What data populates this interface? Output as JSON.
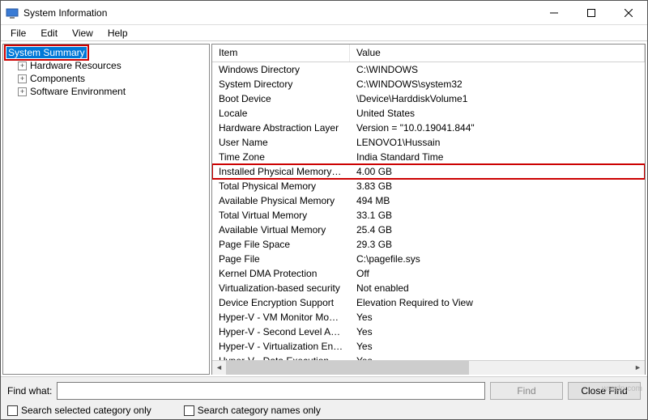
{
  "window": {
    "title": "System Information"
  },
  "menu": {
    "file": "File",
    "edit": "Edit",
    "view": "View",
    "help": "Help"
  },
  "tree": {
    "root": "System Summary",
    "hardware": "Hardware Resources",
    "components": "Components",
    "software": "Software Environment"
  },
  "columns": {
    "item": "Item",
    "value": "Value"
  },
  "rows": [
    {
      "item": "Windows Directory",
      "value": "C:\\WINDOWS"
    },
    {
      "item": "System Directory",
      "value": "C:\\WINDOWS\\system32"
    },
    {
      "item": "Boot Device",
      "value": "\\Device\\HarddiskVolume1"
    },
    {
      "item": "Locale",
      "value": "United States"
    },
    {
      "item": "Hardware Abstraction Layer",
      "value": "Version = \"10.0.19041.844\""
    },
    {
      "item": "User Name",
      "value": "LENOVO1\\Hussain"
    },
    {
      "item": "Time Zone",
      "value": "India Standard Time"
    },
    {
      "item": "Installed Physical Memory (RAM)",
      "value": "4.00 GB",
      "highlight": true
    },
    {
      "item": "Total Physical Memory",
      "value": "3.83 GB"
    },
    {
      "item": "Available Physical Memory",
      "value": "494 MB"
    },
    {
      "item": "Total Virtual Memory",
      "value": "33.1 GB"
    },
    {
      "item": "Available Virtual Memory",
      "value": "25.4 GB"
    },
    {
      "item": "Page File Space",
      "value": "29.3 GB"
    },
    {
      "item": "Page File",
      "value": "C:\\pagefile.sys"
    },
    {
      "item": "Kernel DMA Protection",
      "value": "Off"
    },
    {
      "item": "Virtualization-based security",
      "value": "Not enabled"
    },
    {
      "item": "Device Encryption Support",
      "value": "Elevation Required to View"
    },
    {
      "item": "Hyper-V - VM Monitor Mode E...",
      "value": "Yes"
    },
    {
      "item": "Hyper-V - Second Level Addres...",
      "value": "Yes"
    },
    {
      "item": "Hyper-V - Virtualization Enable...",
      "value": "Yes"
    },
    {
      "item": "Hyper-V - Data Execution Prote...",
      "value": "Yes"
    }
  ],
  "footer": {
    "find_label": "Find what:",
    "find_button": "Find",
    "close_find_button": "Close Find",
    "check_category": "Search selected category only",
    "check_names": "Search category names only"
  },
  "watermark": "wsxdn.com"
}
